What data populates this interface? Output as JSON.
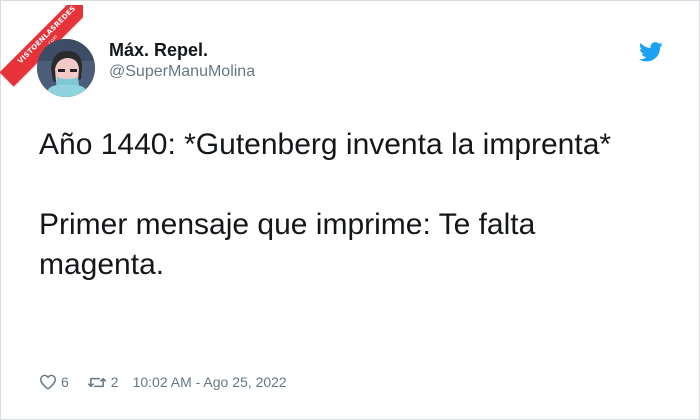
{
  "watermark": {
    "text": "VISTOENLASREDES",
    "sub": ".com"
  },
  "author": {
    "name": "Máx. Repel.",
    "handle": "@SuperManuMolina"
  },
  "tweet": {
    "text": "Año 1440: *Gutenberg inventa la imprenta*\n\nPrimer mensaje que imprime: Te falta magenta."
  },
  "stats": {
    "likes": "6",
    "retweets": "2",
    "timestamp": "10:02 AM - Ago 25, 2022"
  },
  "icons": {
    "brand": "twitter-bird-icon",
    "like": "heart-icon",
    "retweet": "retweet-icon"
  },
  "colors": {
    "brand": "#1DA1F2",
    "watermark": "#E8323A",
    "text": "#14171A",
    "muted": "#657786"
  }
}
